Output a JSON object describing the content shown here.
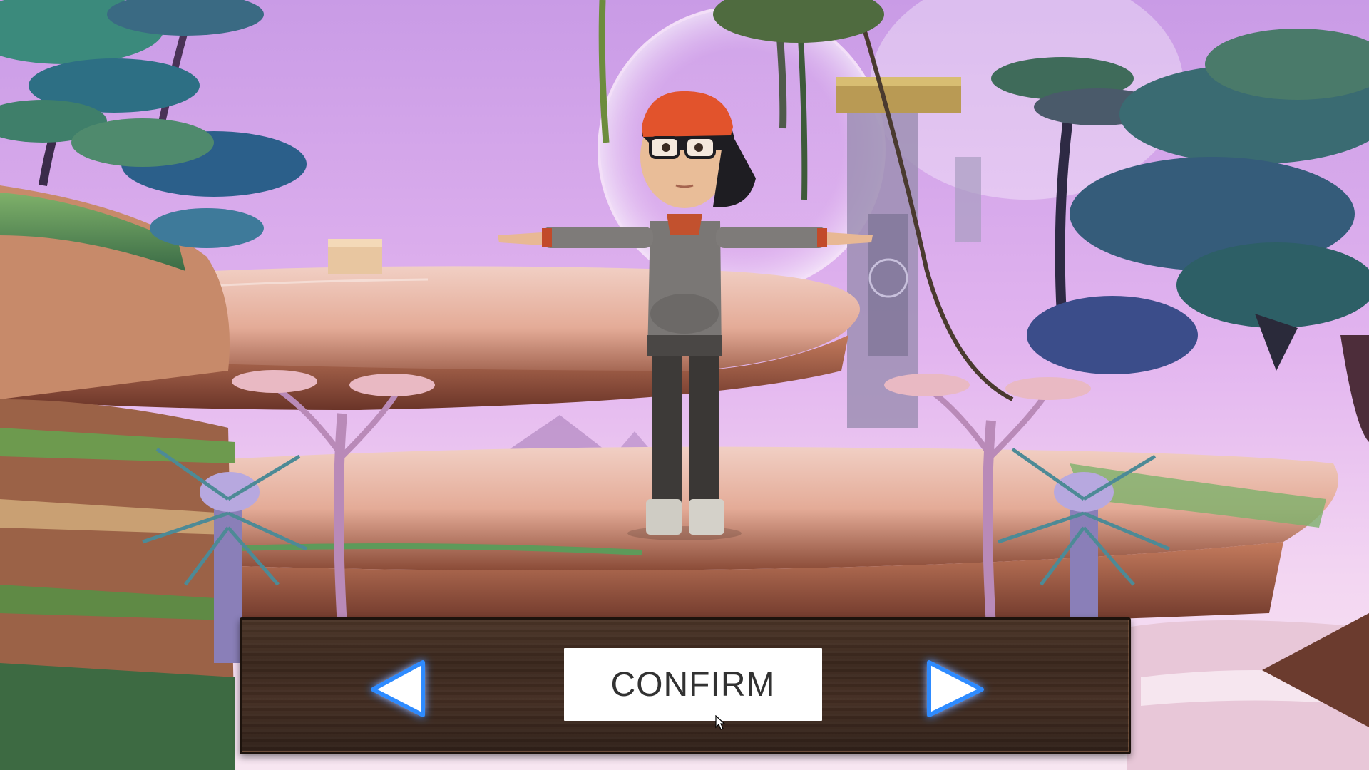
{
  "screen": "character-select",
  "controls": {
    "confirm_label": "CONFIRM",
    "prev_icon": "left-arrow-icon",
    "next_icon": "right-arrow-icon"
  },
  "colors": {
    "sky": "#d9a8ec",
    "panel_wood": "#3f2a1f",
    "button_bg": "#ffffff",
    "button_text": "#323232",
    "arrow_fill": "#ffffff",
    "arrow_glow": "#2f8bff"
  }
}
